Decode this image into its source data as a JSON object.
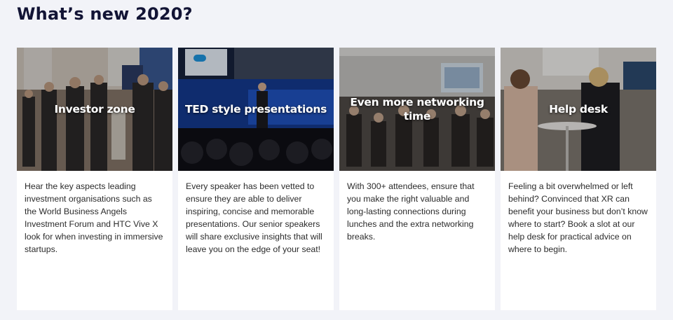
{
  "page": {
    "title": "What’s new 2020?"
  },
  "cards": [
    {
      "title": "Investor zone",
      "description": "Hear the key aspects leading investment organisations such as the World Business Angels Investment Forum and HTC Vive X look for when investing in immersive startups.",
      "image": "photo-of-crowd-networking-at-expo"
    },
    {
      "title": "TED style presentations",
      "description": "Every speaker has been vetted to ensure they are able to deliver inspiring, concise and memorable presentations. Our senior speakers will share exclusive insights that will leave you on the edge of your seat!",
      "image": "photo-of-speaker-on-stage"
    },
    {
      "title": "Even more networking time",
      "description": "With 300+ attendees, ensure that you make the right valuable and long-lasting connections during lunches and the extra networking breaks.",
      "image": "photo-of-attendees-seated-in-hall"
    },
    {
      "title": "Help desk",
      "description": "Feeling a bit overwhelmed or left behind? Convinced that XR can benefit your business but don’t know where to start? Book a slot at our help desk for practical advice on where to begin.",
      "image": "photo-of-women-talking-at-table"
    }
  ],
  "colors": {
    "page_background": "#f2f3f8",
    "title": "#121435",
    "card_background": "#ffffff",
    "body_text": "#2b2b2b"
  }
}
